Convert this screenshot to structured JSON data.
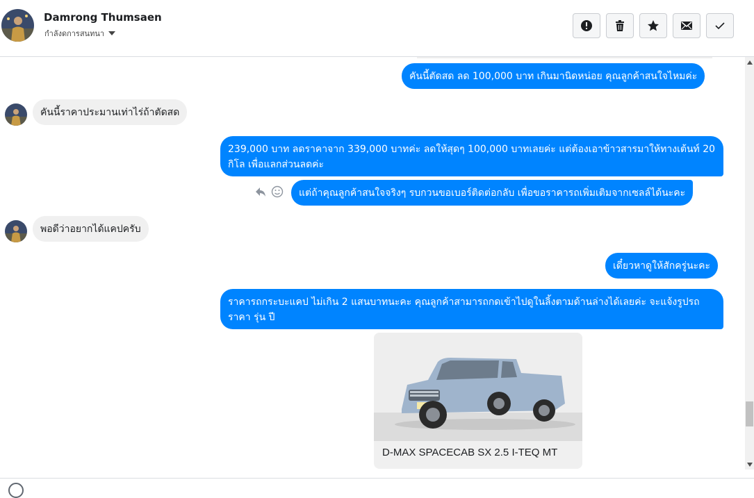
{
  "header": {
    "contact_name": "Damrong Thumsaen",
    "contact_subtitle": "กำลังดการสนทนา",
    "actions": [
      {
        "name": "report",
        "icon": "exclamation-circle-icon"
      },
      {
        "name": "delete",
        "icon": "trash-icon"
      },
      {
        "name": "star",
        "icon": "star-icon"
      },
      {
        "name": "mark-unread",
        "icon": "envelope-icon"
      },
      {
        "name": "mark-done",
        "icon": "checkmark-icon"
      }
    ]
  },
  "messages": [
    {
      "side": "out",
      "text": "คันนี้ตัดสด ลด 100,000 บาท เกินมานิดหน่อย คุณลูกค้าสนใจไหมค่ะ"
    },
    {
      "side": "in",
      "text": "คันนี้ราคาประมานเท่าไร่ถ้าตัดสด"
    },
    {
      "side": "out",
      "text": "239,000 บาท ลดราคาจาก 339,000 บาทค่ะ ลดให้สุดๆ 100,000 บาทเลยค่ะ แต่ต้องเอาข้าวสารมาให้ทางเต้นท์ 20 กิโล เพื่อแลกส่วนลดค่ะ"
    },
    {
      "side": "out",
      "text": "แต่ถ้าคุณลูกค้าสนใจจริงๆ รบกวนขอเบอร์ติดต่อกลับ เพื่อขอราคารถเพิ่มเติมจากเซลล์ได้นะคะ"
    },
    {
      "side": "in",
      "text": "พอดีว่าอยากได้แคปครับ"
    },
    {
      "side": "out",
      "text": "เดี๋ยวหาดูให้สักครู่นะคะ"
    },
    {
      "side": "out",
      "text": "ราคารถกระบะแคป ไม่เกิน 2 แสนบาทนะคะ คุณลูกค้าสามารถกดเข้าไปดูในลิ้งตามด้านล่างได้เลยค่ะ จะแจ้งรูปรถ ราคา รุ่น ปี"
    }
  ],
  "card": {
    "title": "D-MAX SPACECAB SX 2.5 I-TEQ MT",
    "image": "silver-pickup-truck-photo"
  },
  "colors": {
    "outgoing_bubble": "#0084ff",
    "incoming_bubble": "#f0f0f0"
  }
}
